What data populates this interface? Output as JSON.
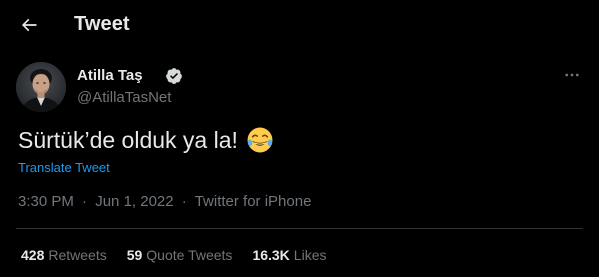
{
  "header": {
    "title": "Tweet",
    "back_icon": "arrow-left-icon"
  },
  "author": {
    "display_name": "Atilla Taş",
    "handle": "@AtillaTasNet",
    "verified": true,
    "verified_icon": "verified-badge-icon",
    "more_icon": "more-dots-icon"
  },
  "tweet": {
    "text": "Sürtük’de olduk ya la!",
    "emoji": "face-with-tears-of-joy-icon",
    "translate_label": "Translate Tweet",
    "time": "3:30 PM",
    "date": "Jun 1, 2022",
    "source": "Twitter for iPhone",
    "separator": "·"
  },
  "stats": {
    "retweets_count": "428",
    "retweets_label": "Retweets",
    "quotes_count": "59",
    "quotes_label": "Quote Tweets",
    "likes_count": "16.3K",
    "likes_label": "Likes"
  },
  "colors": {
    "background": "#000000",
    "text_primary": "#e7e9ea",
    "text_secondary": "#71767b",
    "link": "#1d9bf0",
    "divider": "#2f3336"
  }
}
